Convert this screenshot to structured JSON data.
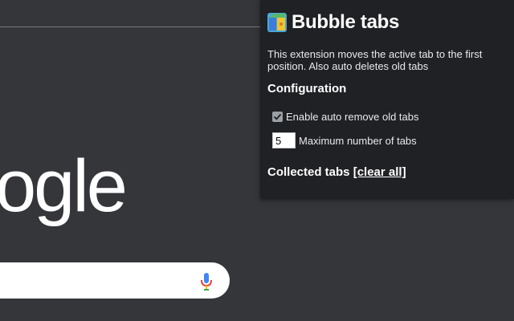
{
  "background": {
    "logo_fragment": "ogle",
    "icons": {
      "mic": "microphone-icon"
    }
  },
  "popup": {
    "icon": "bubble-tabs-app-icon",
    "title": "Bubble tabs",
    "description": "This extension moves the active tab to the first position. Also auto deletes old tabs",
    "config_heading": "Configuration",
    "auto_remove": {
      "label": "Enable auto remove old tabs",
      "checked": true
    },
    "max_tabs": {
      "label": "Maximum number of tabs",
      "value": "5"
    },
    "collected": {
      "label": "Collected tabs",
      "link_text": "[clear all]"
    }
  },
  "colors": {
    "page_bg": "#35363a",
    "popup_bg": "#202124",
    "text": "#e8eaed"
  }
}
